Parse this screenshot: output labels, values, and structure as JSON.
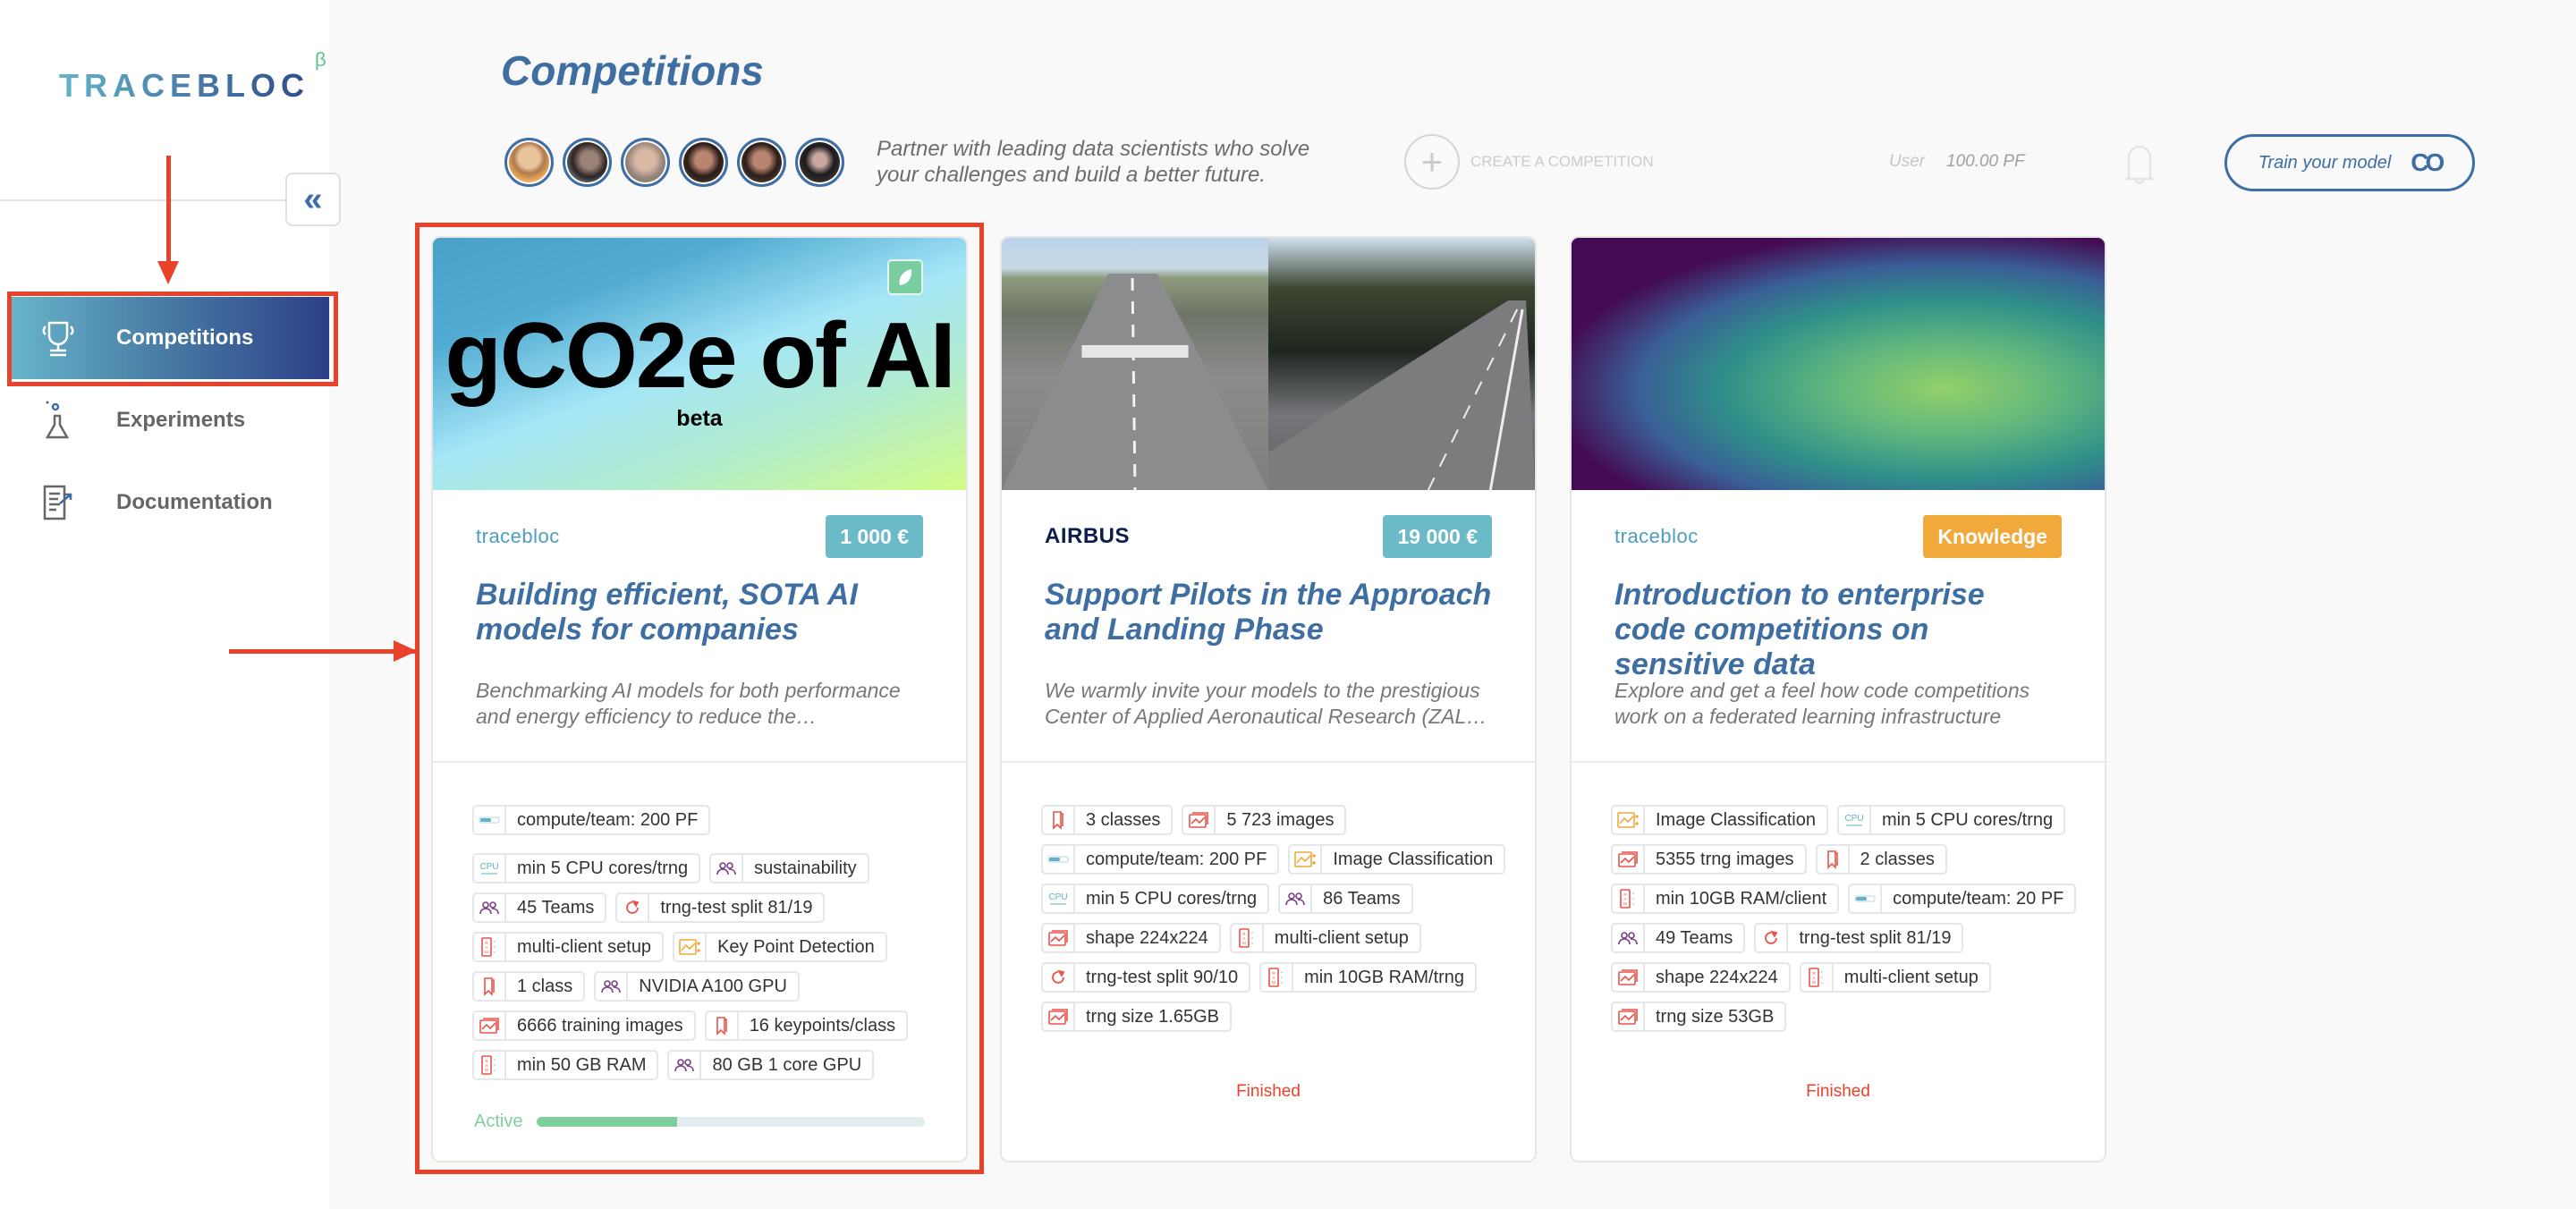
{
  "app": {
    "logo_text": "TRACEBLOC",
    "logo_badge": "β"
  },
  "sidebar": {
    "collapse_label": "«",
    "items": [
      {
        "label": "Competitions",
        "icon": "trophy-icon",
        "active": true
      },
      {
        "label": "Experiments",
        "icon": "flask-icon",
        "active": false
      },
      {
        "label": "Documentation",
        "icon": "document-icon",
        "active": false
      }
    ]
  },
  "header": {
    "title": "Competitions",
    "avatar_count": 6,
    "tagline": "Partner with leading data scientists who solve your challenges and build a better future.",
    "create_label": "CREATE A COMPETITION",
    "user_label": "User",
    "credits": "100.00 PF",
    "train_label": "Train your model",
    "train_icon_text": "CO"
  },
  "colors": {
    "accent": "#3f6fa2",
    "prize": "#6bbac8",
    "knowledge": "#f2a93b",
    "active": "#7ccf9c",
    "finished": "#e8432a",
    "annotation": "#e8432a"
  },
  "cards": [
    {
      "image_title": "gCO2e of AI",
      "image_subtitle": "beta",
      "company": "tracebloc",
      "prize": "1 000 €",
      "title": "Building efficient, SOTA AI models for companies",
      "description": "Benchmarking AI models for both performance and energy efficiency to reduce the…",
      "tags": [
        {
          "icon": "compute-icon",
          "label": "compute/team: 200 PF"
        },
        {
          "break": true
        },
        {
          "icon": "cpu-icon",
          "label": "min 5 CPU cores/trng"
        },
        {
          "icon": "teams-icon",
          "label": "sustainability"
        },
        {
          "icon": "teams-icon",
          "label": "45 Teams"
        },
        {
          "icon": "split-icon",
          "label": "trng-test split 81/19"
        },
        {
          "icon": "ram-icon",
          "label": "multi-client setup"
        },
        {
          "icon": "task-icon",
          "label": "Key Point Detection"
        },
        {
          "icon": "class-icon",
          "label": "1 class"
        },
        {
          "icon": "teams-icon",
          "label": "NVIDIA A100 GPU"
        },
        {
          "icon": "images-icon",
          "label": "6666 training images"
        },
        {
          "icon": "class-icon",
          "label": "16 keypoints/class"
        },
        {
          "icon": "ram-icon",
          "label": "min 50 GB RAM"
        },
        {
          "icon": "teams-icon",
          "label": "80 GB 1 core GPU"
        }
      ],
      "status": "Active",
      "progress": 0.36
    },
    {
      "company": "AIRBUS",
      "prize": "19 000 €",
      "title": "Support Pilots in the Approach and Landing Phase",
      "description": "We warmly invite your models to the prestigious Center of Applied Aeronautical Research (ZAL…",
      "tags": [
        {
          "icon": "class-icon",
          "label": "3 classes"
        },
        {
          "icon": "images-icon",
          "label": "5 723 images"
        },
        {
          "icon": "compute-icon",
          "label": "compute/team: 200 PF"
        },
        {
          "icon": "task-icon",
          "label": "Image Classification"
        },
        {
          "icon": "cpu-icon",
          "label": "min 5 CPU cores/trng"
        },
        {
          "icon": "teams-icon",
          "label": "86 Teams"
        },
        {
          "icon": "images-icon",
          "label": "shape 224x224"
        },
        {
          "icon": "ram-icon",
          "label": "multi-client setup"
        },
        {
          "icon": "split-icon",
          "label": "trng-test split 90/10"
        },
        {
          "icon": "ram-icon",
          "label": "min 10GB RAM/trng"
        },
        {
          "icon": "images-icon",
          "label": "trng size 1.65GB"
        }
      ],
      "status": "Finished"
    },
    {
      "company": "tracebloc",
      "prize": "Knowledge",
      "title": "Introduction to enterprise code competitions on sensitive data",
      "description": "Explore and get a feel how code competitions work on a federated learning infrastructure",
      "tags": [
        {
          "icon": "task-icon",
          "label": "Image Classification"
        },
        {
          "icon": "cpu-icon",
          "label": "min 5 CPU cores/trng"
        },
        {
          "icon": "images-icon",
          "label": "5355 trng images"
        },
        {
          "icon": "class-icon",
          "label": "2 classes"
        },
        {
          "icon": "ram-icon",
          "label": "min 10GB RAM/client"
        },
        {
          "icon": "compute-icon",
          "label": "compute/team: 20 PF"
        },
        {
          "icon": "teams-icon",
          "label": "49 Teams"
        },
        {
          "icon": "split-icon",
          "label": "trng-test split 81/19"
        },
        {
          "icon": "images-icon",
          "label": "shape 224x224"
        },
        {
          "icon": "ram-icon",
          "label": "multi-client setup"
        },
        {
          "icon": "images-icon",
          "label": "trng size 53GB"
        }
      ],
      "status": "Finished"
    }
  ]
}
